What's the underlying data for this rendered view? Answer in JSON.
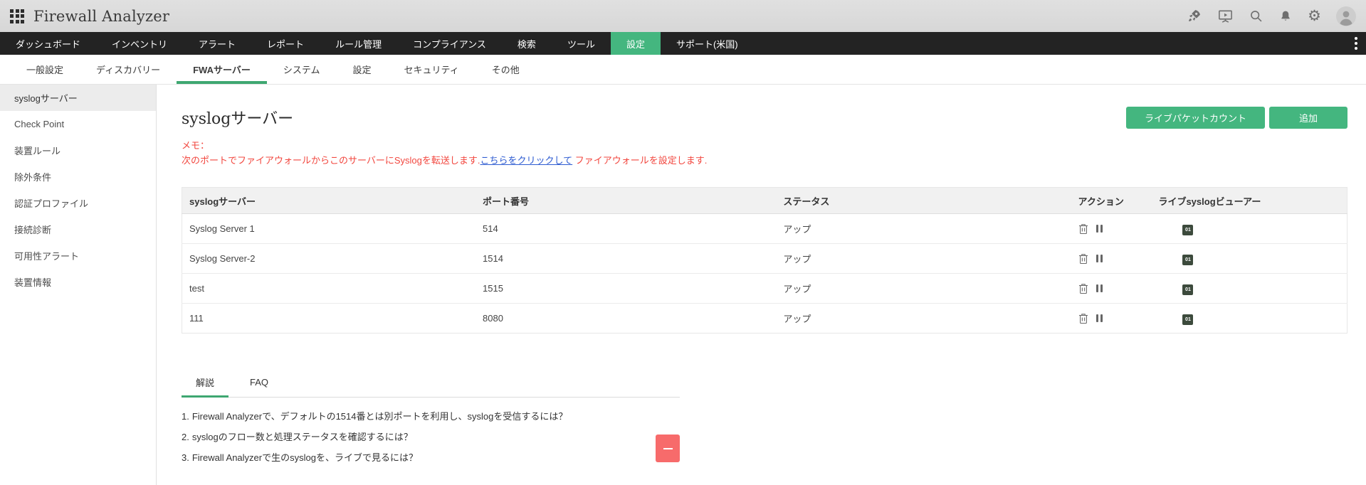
{
  "app": {
    "title": "Firewall Analyzer"
  },
  "nav": {
    "items": [
      {
        "label": "ダッシュボード",
        "active": false
      },
      {
        "label": "インベントリ",
        "active": false
      },
      {
        "label": "アラート",
        "active": false
      },
      {
        "label": "レポート",
        "active": false
      },
      {
        "label": "ルール管理",
        "active": false
      },
      {
        "label": "コンプライアンス",
        "active": false
      },
      {
        "label": "検索",
        "active": false
      },
      {
        "label": "ツール",
        "active": false
      },
      {
        "label": "設定",
        "active": true
      },
      {
        "label": "サポート(米国)",
        "active": false
      }
    ]
  },
  "subtabs": {
    "items": [
      {
        "label": "一般設定",
        "active": false
      },
      {
        "label": "ディスカバリー",
        "active": false
      },
      {
        "label": "FWAサーバー",
        "active": true
      },
      {
        "label": "システム",
        "active": false
      },
      {
        "label": "設定",
        "active": false
      },
      {
        "label": "セキュリティ",
        "active": false
      },
      {
        "label": "その他",
        "active": false
      }
    ]
  },
  "sidebar": {
    "items": [
      {
        "label": "syslogサーバー",
        "active": true
      },
      {
        "label": "Check Point",
        "active": false
      },
      {
        "label": "装置ルール",
        "active": false
      },
      {
        "label": "除外条件",
        "active": false
      },
      {
        "label": "認証プロファイル",
        "active": false
      },
      {
        "label": "接続診断",
        "active": false
      },
      {
        "label": "可用性アラート",
        "active": false
      },
      {
        "label": "装置情報",
        "active": false
      }
    ]
  },
  "page": {
    "title": "syslogサーバー",
    "actions": {
      "live_packet_count": "ライブパケットカウント",
      "add": "追加"
    },
    "memo": {
      "label": "メモ：",
      "text_before": "次のポートでファイアウォールからこのサーバーにSyslogを転送します.",
      "link": "こちらをクリックして",
      "text_after": " ファイアウォールを設定します."
    }
  },
  "table": {
    "columns": [
      "syslogサーバー",
      "ポート番号",
      "ステータス",
      "アクション",
      "ライブsyslogビューアー"
    ],
    "badge_text": "01",
    "rows": [
      {
        "name": "Syslog Server 1",
        "port": "514",
        "status": "アップ"
      },
      {
        "name": "Syslog Server-2",
        "port": "1514",
        "status": "アップ"
      },
      {
        "name": "test",
        "port": "1515",
        "status": "アップ"
      },
      {
        "name": "111",
        "port": "8080",
        "status": "アップ"
      }
    ]
  },
  "help": {
    "tabs": [
      {
        "label": "解説",
        "active": true
      },
      {
        "label": "FAQ",
        "active": false
      }
    ],
    "faq": [
      {
        "num": "1.",
        "text": "Firewall Analyzerで、デフォルトの1514番とは別ポートを利用し、syslogを受信するには？"
      },
      {
        "num": "2.",
        "text": "syslogのフロー数と処理ステータスを確認するには？"
      },
      {
        "num": "3.",
        "text": "Firewall Analyzerで生のsyslogを、ライブで見るには？"
      }
    ]
  },
  "colors": {
    "accent_green": "#44b67f",
    "memo_red": "#f2473f",
    "link_blue": "#2d5bd1",
    "collapse_red": "#f76b6b",
    "nav_black": "#232323"
  }
}
